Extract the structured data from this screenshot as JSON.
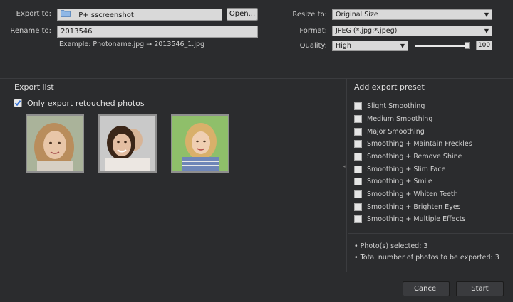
{
  "export": {
    "export_to_label": "Export to:",
    "export_to_value": "P+ sscreenshot",
    "open_label": "Open...",
    "rename_to_label": "Rename to:",
    "rename_to_value": "2013546",
    "example_text": "Example: Photoname.jpg → 2013546_1.jpg"
  },
  "settings": {
    "resize_label": "Resize to:",
    "resize_value": "Original Size",
    "format_label": "Format:",
    "format_value": "JPEG (*.jpg;*.jpeg)",
    "quality_label": "Quality:",
    "quality_value": "High",
    "quality_number": "100",
    "quality_level": 1.0
  },
  "export_list": {
    "title": "Export list",
    "only_retouched_label": "Only export retouched photos",
    "only_retouched_checked": true,
    "photos": [
      {
        "name": "photo-1"
      },
      {
        "name": "photo-2"
      },
      {
        "name": "photo-3"
      }
    ]
  },
  "presets": {
    "title": "Add export preset",
    "items": [
      {
        "label": "Slight Smoothing"
      },
      {
        "label": "Medium Smoothing"
      },
      {
        "label": "Major Smoothing"
      },
      {
        "label": "Smoothing + Maintain Freckles"
      },
      {
        "label": "Smoothing + Remove Shine"
      },
      {
        "label": "Smoothing + Slim Face"
      },
      {
        "label": "Smoothing + Smile"
      },
      {
        "label": "Smoothing + Whiten Teeth"
      },
      {
        "label": "Smoothing + Brighten Eyes"
      },
      {
        "label": "Smoothing + Multiple Effects"
      }
    ],
    "summary_selected": "Photo(s) selected: 3",
    "summary_total": "Total number of photos to be exported: 3"
  },
  "footer": {
    "cancel_label": "Cancel",
    "start_label": "Start"
  },
  "colors": {
    "background": "#2b2c2e",
    "checkbox_accent": "#2f6fd6"
  }
}
